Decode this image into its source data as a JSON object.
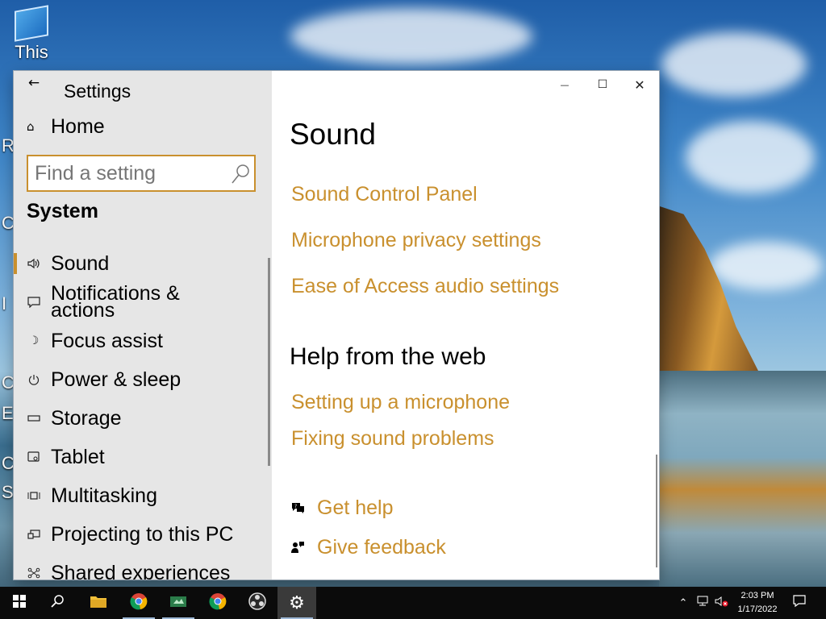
{
  "desktop": {
    "icon_label": "This",
    "edge_letters": [
      "R",
      "C",
      "I",
      "C",
      "E",
      "C",
      "S"
    ]
  },
  "window": {
    "app_title": "Settings",
    "controls": {
      "minimize": "—",
      "maximize": "☐",
      "close": "✕"
    }
  },
  "sidebar": {
    "home_label": "Home",
    "search_placeholder": "Find a setting",
    "section_label": "System",
    "items": [
      {
        "label": "Sound",
        "icon": "speaker-icon",
        "selected": true
      },
      {
        "label": "Notifications &",
        "label2": "actions",
        "icon": "notification-icon"
      },
      {
        "label": "Focus assist",
        "icon": "moon-icon"
      },
      {
        "label": "Power & sleep",
        "icon": "power-icon"
      },
      {
        "label": "Storage",
        "icon": "storage-icon"
      },
      {
        "label": "Tablet",
        "icon": "tablet-icon"
      },
      {
        "label": "Multitasking",
        "icon": "multitasking-icon"
      },
      {
        "label": "Projecting to this PC",
        "icon": "projector-icon"
      },
      {
        "label": "Shared experiences",
        "icon": "shared-icon"
      }
    ]
  },
  "main": {
    "title": "Sound",
    "related_links": [
      "Sound Control Panel",
      "Microphone privacy settings",
      "Ease of Access audio settings"
    ],
    "help_heading": "Help from the web",
    "web_links": [
      "Setting up a microphone",
      "Fixing sound problems"
    ],
    "help": {
      "get_help": "Get help",
      "give_feedback": "Give feedback"
    }
  },
  "taskbar": {
    "time": "2:03 PM",
    "date": "1/17/2022",
    "apps": [
      "start-icon",
      "search-icon",
      "file-explorer-icon",
      "chrome-icon",
      "app-icon",
      "chrome-icon",
      "obs-icon",
      "settings-icon"
    ]
  },
  "colors": {
    "accent": "#c9902e",
    "nav_bg": "#e6e6e6",
    "taskbar": "#0b0b0b"
  }
}
